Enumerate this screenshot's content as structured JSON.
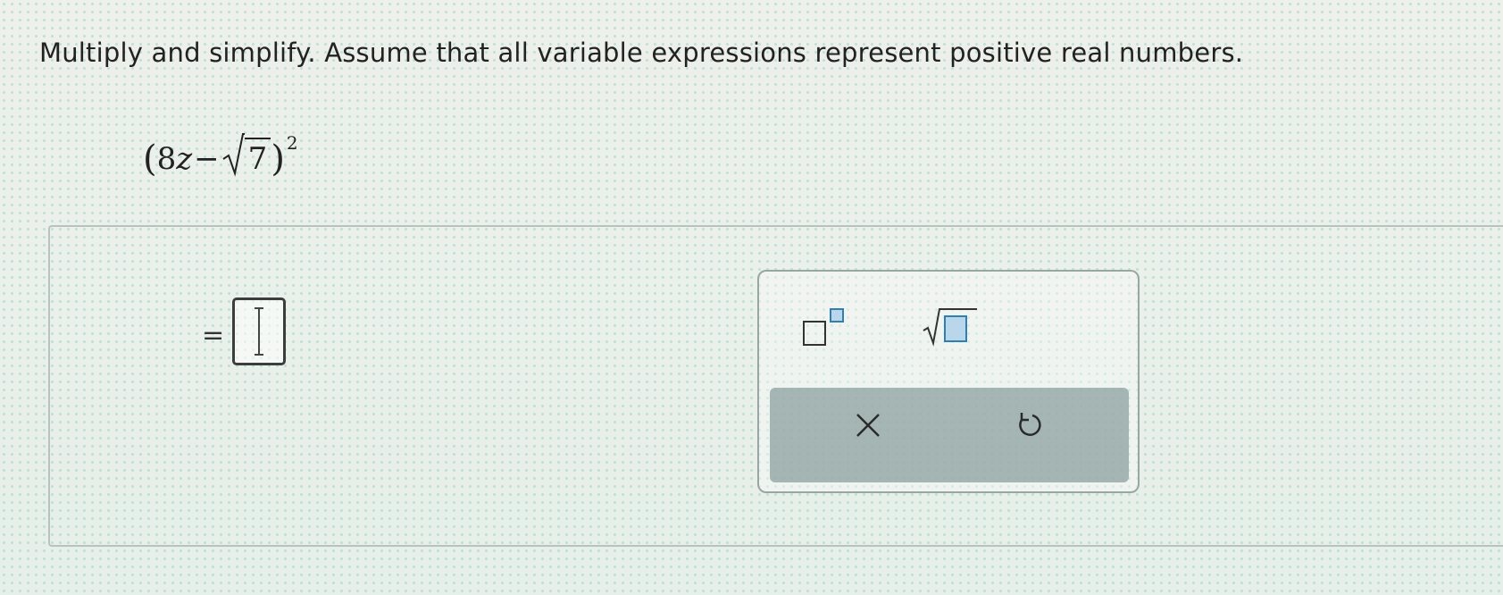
{
  "instruction": "Multiply and simplify. Assume that all variable expressions represent positive real numbers.",
  "expression": {
    "open_paren": "(",
    "coefficient": "8",
    "variable": "z",
    "operator": "−",
    "radicand": "7",
    "close_paren": ")",
    "exponent": "2"
  },
  "answer": {
    "equals_sign": "=",
    "value": ""
  },
  "palette": {
    "tools": [
      {
        "name": "exponent",
        "icon": "exponent-template-icon"
      },
      {
        "name": "square root",
        "icon": "sqrt-template-icon"
      }
    ],
    "actions": [
      {
        "name": "clear",
        "icon": "close-icon"
      },
      {
        "name": "undo",
        "icon": "undo-icon"
      }
    ]
  },
  "colors": {
    "panel_border": "#b9c2bf",
    "palette_action_bar": "#8ca0a0",
    "template_box": "#2f7fb0",
    "text": "#222222"
  }
}
